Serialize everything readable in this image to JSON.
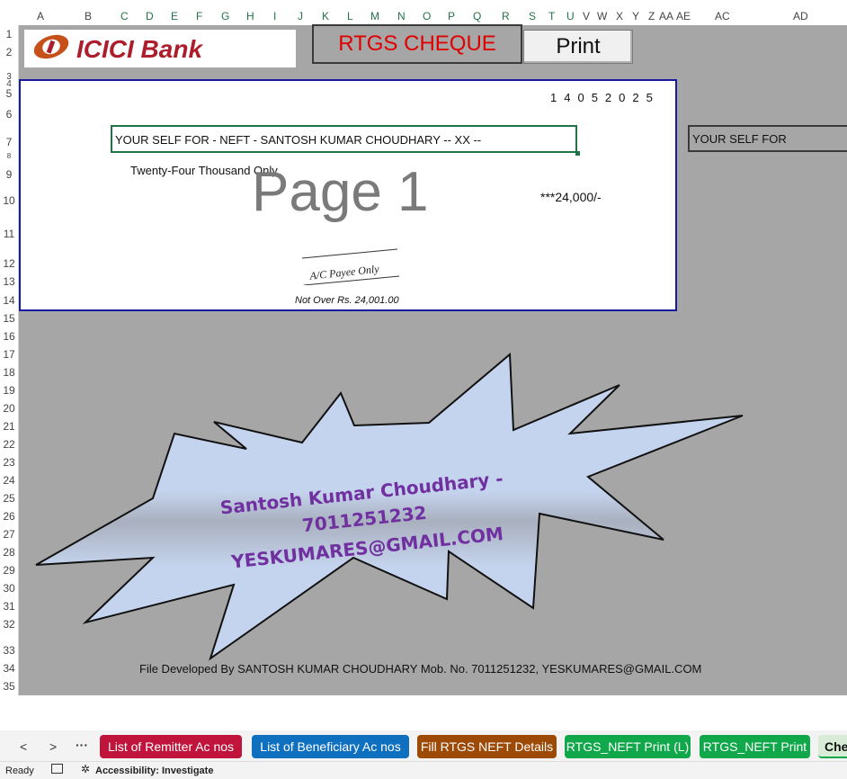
{
  "column_headers": [
    "A",
    "B",
    "C",
    "D",
    "E",
    "F",
    "G",
    "H",
    "I",
    "J",
    "K",
    "L",
    "M",
    "N",
    "O",
    "P",
    "Q",
    "R",
    "S",
    "T",
    "U",
    "V",
    "W",
    "X",
    "Y",
    "Z",
    "AA",
    "AE",
    "AC",
    "AD"
  ],
  "row_headers": [
    "1",
    "2",
    "3",
    "4",
    "5",
    "6",
    "7",
    "8",
    "9",
    "10",
    "11",
    "12",
    "13",
    "14",
    "15",
    "16",
    "17",
    "18",
    "19",
    "20",
    "21",
    "22",
    "23",
    "24",
    "25",
    "26",
    "27",
    "28",
    "29",
    "30",
    "31",
    "32",
    "33",
    "34",
    "35"
  ],
  "logo_text": "ICICI Bank",
  "title_box": "RTGS CHEQUE",
  "print_button": "Print",
  "cheque": {
    "date_digits": "14052025",
    "payee_line": "YOUR SELF FOR  - NEFT - SANTOSH KUMAR CHOUDHARY   -- XX --",
    "amount_words": "Twenty-Four Thousand Only",
    "watermark": "Page 1",
    "amount_figures": "***24,000/-",
    "crossing": "A/C Payee Only",
    "not_over": "Not Over Rs. 24,001.00"
  },
  "side_reference": "YOUR SELF FOR",
  "promo": {
    "name": "Santosh Kumar Choudhary -",
    "phone": "7011251232",
    "email": "YESKUMARES@GMAIL.COM"
  },
  "footer_note": "File Developed By SANTOSH KUMAR CHOUDHARY Mob. No. 7011251232, YESKUMARES@GMAIL.COM",
  "sheet_nav": {
    "prev": "<",
    "next": ">",
    "more": "···"
  },
  "sheet_tabs": [
    {
      "label": "List of Remitter Ac nos",
      "color": "#c0143c"
    },
    {
      "label": "List of Beneficiary Ac nos",
      "color": "#1070c0"
    },
    {
      "label": "Fill RTGS NEFT Details",
      "color": "#9c4a06"
    },
    {
      "label": "RTGS_NEFT Print (L)",
      "color": "#10a84a"
    },
    {
      "label": "RTGS_NEFT Print",
      "color": "#10a84a"
    },
    {
      "label": "Che",
      "color": "#d8ecd8"
    }
  ],
  "status_bar": {
    "ready": "Ready",
    "accessibility": "Accessibility: Investigate"
  },
  "colors": {
    "sheet_bg": "#a6a6a6",
    "cheque_border": "#1a1aa0",
    "title_red": "#e00000",
    "promo_purple": "#7030a0"
  }
}
